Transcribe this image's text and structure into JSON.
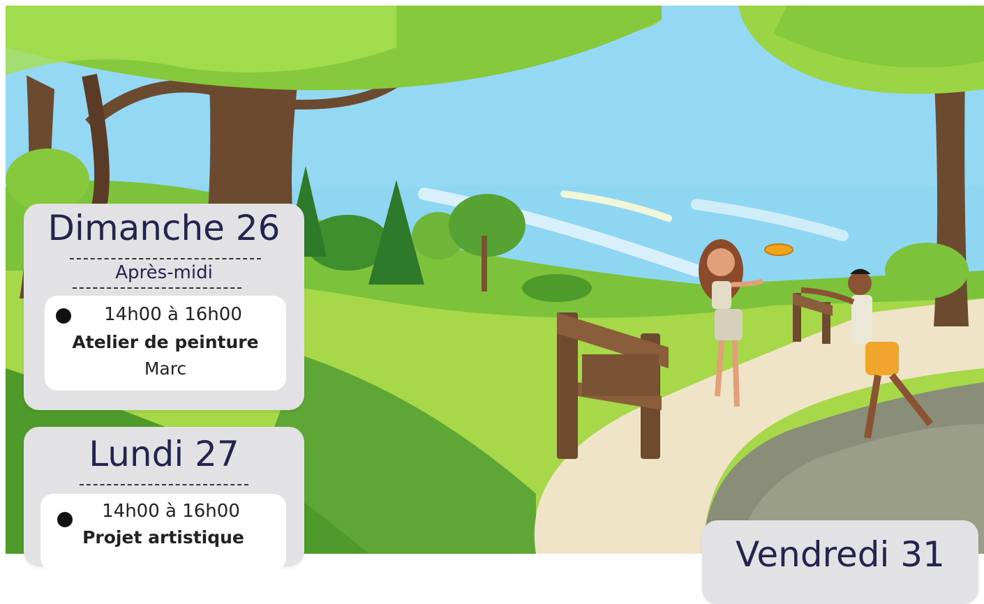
{
  "colors": {
    "sky": "#8fd6f2",
    "grass_light": "#a6d84a",
    "grass_dark": "#4e9a2a",
    "path": "#efe3c8",
    "card_bg": "#e2e2e4",
    "title_text": "#24244f"
  },
  "cards": [
    {
      "day": "Dimanche 26",
      "period": "Après-midi",
      "events": [
        {
          "time": "14h00 à 16h00",
          "name": "Atelier de peinture",
          "host": "Marc"
        }
      ]
    },
    {
      "day": "Lundi 27",
      "events": [
        {
          "time": "14h00 à 16h00",
          "name": "Projet artistique"
        }
      ]
    },
    {
      "day": "Vendredi 31"
    }
  ]
}
